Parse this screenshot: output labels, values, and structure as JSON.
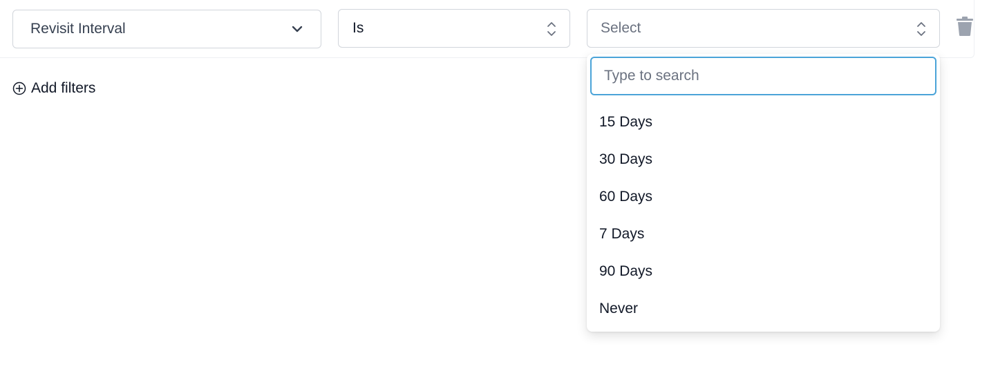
{
  "filter": {
    "attribute": {
      "value": "Revisit Interval"
    },
    "operator": {
      "value": "Is"
    },
    "value": {
      "placeholder": "Select"
    }
  },
  "add_filters_label": "Add filters",
  "dropdown": {
    "search_placeholder": "Type to search",
    "search_value": "",
    "options": [
      "15 Days",
      "30 Days",
      "60 Days",
      "7 Days",
      "90 Days",
      "Never"
    ]
  },
  "icons": {
    "attribute_chevron": "chevron-down-icon",
    "operator_chevrons": "chevron-up-down-icon",
    "value_chevrons": "chevron-up-down-icon",
    "delete": "trash-icon",
    "add": "plus-circle-icon"
  },
  "colors": {
    "focus_border": "#4aa3d8",
    "border": "#d1d5db",
    "icon_gray": "#6b7280"
  }
}
